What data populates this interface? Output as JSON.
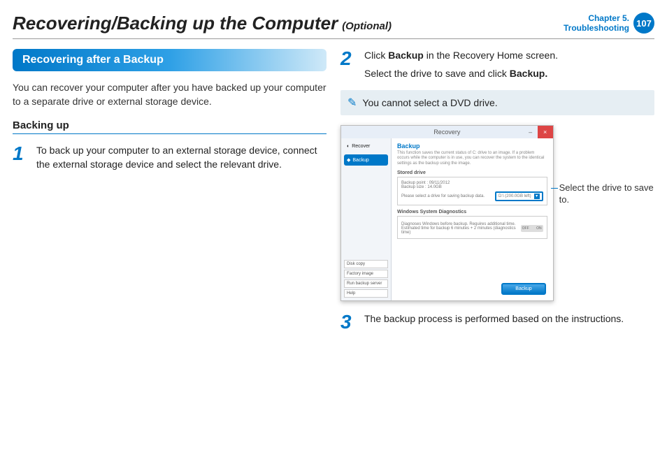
{
  "header": {
    "title": "Recovering/Backing up the Computer",
    "optional": "(Optional)",
    "chapter_line1": "Chapter 5.",
    "chapter_line2": "Troubleshooting",
    "page": "107"
  },
  "left": {
    "section_title": "Recovering after a Backup",
    "intro": "You can recover your computer after you have backed up your computer to a separate drive or external storage device.",
    "sub_heading": "Backing up",
    "step1_num": "1",
    "step1_text": "To back up your computer to an external storage device, connect the external storage device and select the relevant drive."
  },
  "right": {
    "step2_num": "2",
    "step2_pre": "Click ",
    "step2_bold1": "Backup",
    "step2_mid": " in the Recovery Home screen.",
    "step2_line2_pre": "Select the drive to save and click ",
    "step2_bold2": "Backup.",
    "note": "You cannot select a DVD drive.",
    "step3_num": "3",
    "step3_text": "The backup process is performed based on the instructions.",
    "callout": "Select the drive to save to."
  },
  "screenshot": {
    "window_title": "Recovery",
    "nav": {
      "recover": "Recover",
      "backup": "Backup"
    },
    "bottom_list": {
      "disk_copy": "Disk copy",
      "factory_image": "Factory image",
      "run_backup_server": "Run backup server",
      "help": "Help"
    },
    "main": {
      "heading": "Backup",
      "desc": "This function saves the current status of C: drive to an image. If a problem occurs while the computer is in use, you can recover the system to the identical settings as the backup using the image.",
      "stored_drive_label": "Stored drive",
      "backup_point": "Backup point : 09/11/2012",
      "backup_size": "Backup size : 14.0GB",
      "select_prompt": "Please select a drive for saving backup data.",
      "dropdown_value": "D:\\ (200.0GB left)",
      "diag_heading": "Windows System Diagnostics",
      "diag_text": "Diagnoses Windows before backup. Requires additional time. Estimated time for backup 6 minutes + 2 minutes (diagnostics time)",
      "toggle_off": "OFF",
      "toggle_on": "ON",
      "backup_button": "Backup"
    }
  }
}
